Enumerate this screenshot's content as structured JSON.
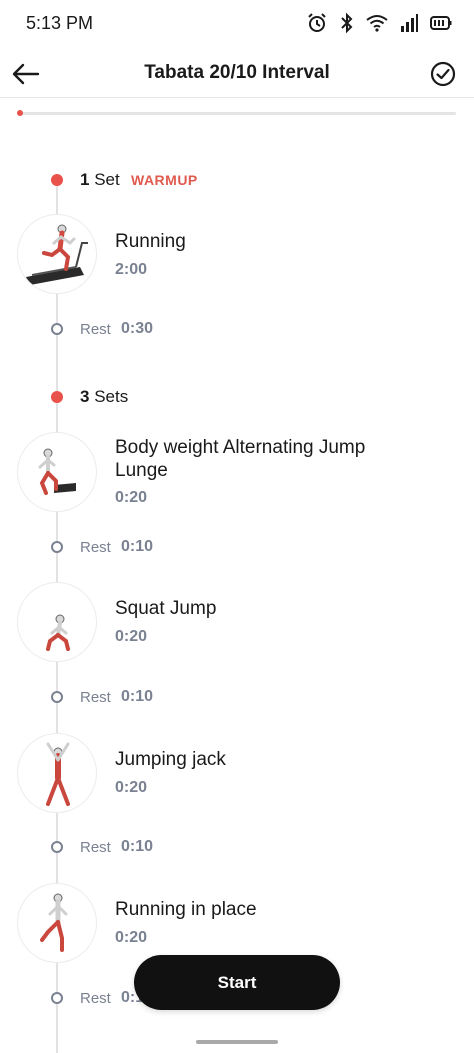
{
  "status_bar": {
    "time": "5:13 PM",
    "icons": [
      "alarm-icon",
      "bluetooth-icon",
      "wifi-icon",
      "signal-icon",
      "battery-icon"
    ]
  },
  "header": {
    "title": "Tabata 20/10 Interval",
    "back_icon": "back-arrow-icon",
    "check_icon": "check-circle-icon"
  },
  "progress": {
    "fraction": 0.01,
    "color": "#e8524a"
  },
  "sets": [
    {
      "count": "1",
      "label": "Set",
      "tag": "WARMUP",
      "items": [
        {
          "name": "Running",
          "duration": "2:00",
          "rest_label": "Rest",
          "rest": "0:30"
        }
      ]
    },
    {
      "count": "3",
      "label": "Sets",
      "tag": "",
      "items": [
        {
          "name": "Body weight Alternating Jump Lunge",
          "duration": "0:20",
          "rest_label": "Rest",
          "rest": "0:10"
        },
        {
          "name": "Squat Jump",
          "duration": "0:20",
          "rest_label": "Rest",
          "rest": "0:10"
        },
        {
          "name": "Jumping jack",
          "duration": "0:20",
          "rest_label": "Rest",
          "rest": "0:10"
        },
        {
          "name": "Running in place",
          "duration": "0:20",
          "rest_label": "Rest",
          "rest": "0:1"
        }
      ]
    }
  ],
  "start_button": {
    "label": "Start"
  },
  "colors": {
    "accent": "#e8524a",
    "muted": "#7a8191",
    "button": "#111111"
  }
}
